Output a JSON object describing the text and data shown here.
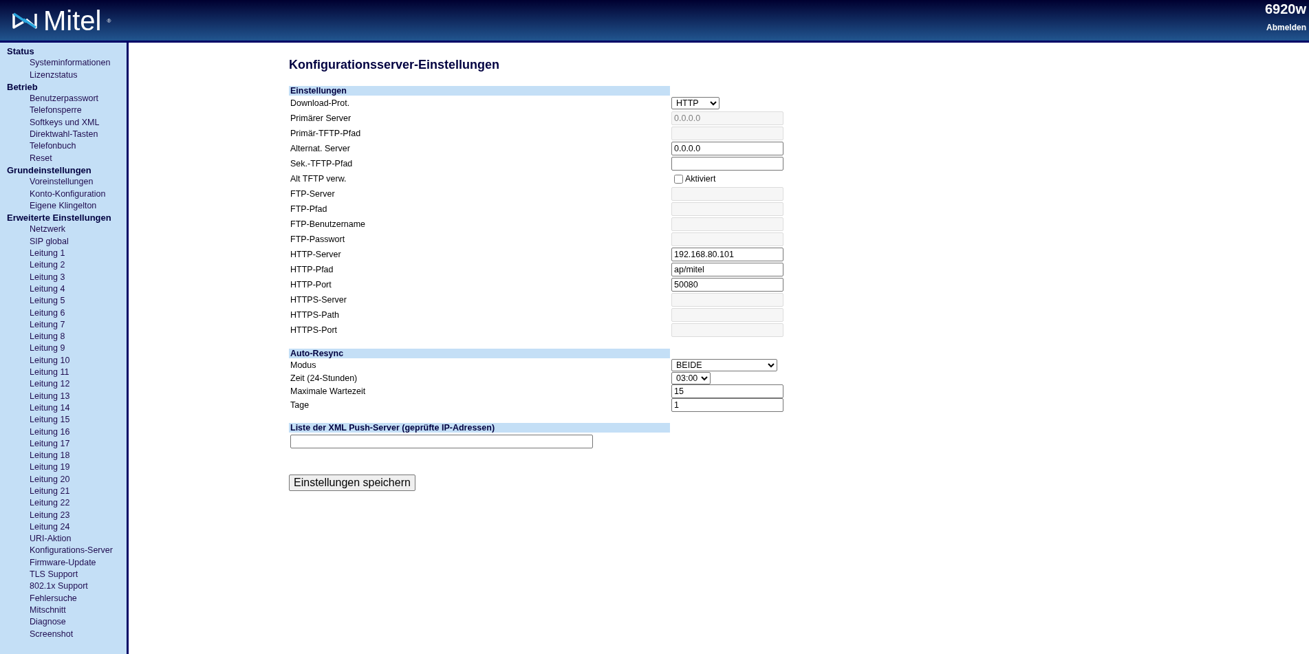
{
  "header": {
    "logo": {
      "text": "Mitel",
      "mark": "®"
    },
    "model": "6920w",
    "logout": "Abmelden"
  },
  "sidebar": {
    "groups": [
      {
        "title": "Status",
        "items": [
          "Systeminformationen",
          "Lizenzstatus"
        ]
      },
      {
        "title": "Betrieb",
        "items": [
          "Benutzerpasswort",
          "Telefonsperre",
          "Softkeys und XML",
          "Direktwahl-Tasten",
          "Telefonbuch",
          "Reset"
        ]
      },
      {
        "title": "Grundeinstellungen",
        "items": [
          "Voreinstellungen",
          "Konto-Konfiguration",
          "Eigene Klingelton"
        ]
      },
      {
        "title": "Erweiterte Einstellungen",
        "items": [
          "Netzwerk",
          "SIP global",
          "Leitung 1",
          "Leitung 2",
          "Leitung 3",
          "Leitung 4",
          "Leitung 5",
          "Leitung 6",
          "Leitung 7",
          "Leitung 8",
          "Leitung 9",
          "Leitung 10",
          "Leitung 11",
          "Leitung 12",
          "Leitung 13",
          "Leitung 14",
          "Leitung 15",
          "Leitung 16",
          "Leitung 17",
          "Leitung 18",
          "Leitung 19",
          "Leitung 20",
          "Leitung 21",
          "Leitung 22",
          "Leitung 23",
          "Leitung 24",
          "URI-Aktion",
          "Konfigurations-Server",
          "Firmware-Update",
          "TLS Support",
          "802.1x Support",
          "Fehlersuche",
          "Mitschnitt",
          "Diagnose",
          "Screenshot"
        ]
      }
    ]
  },
  "page_title": "Konfigurationsserver-Einstellungen",
  "sections": [
    {
      "title": "Einstellungen",
      "rows": [
        {
          "kind": "select",
          "label": "Download-Prot.",
          "value": "HTTP",
          "disabled": false
        },
        {
          "kind": "text",
          "label": "Primärer Server",
          "value": "0.0.0.0",
          "disabled": true
        },
        {
          "kind": "text",
          "label": "Primär-TFTP-Pfad",
          "disabled": true
        },
        {
          "kind": "text",
          "label": "Alternat. Server",
          "value": "0.0.0.0",
          "disabled": false
        },
        {
          "kind": "text",
          "label": "Sek.-TFTP-Pfad",
          "disabled": false
        },
        {
          "kind": "checkbox",
          "label": "Alt TFTP verw.",
          "option": "Aktiviert",
          "checked": false
        },
        {
          "kind": "text",
          "label": "FTP-Server",
          "disabled": true
        },
        {
          "kind": "text",
          "label": "FTP-Pfad",
          "disabled": true
        },
        {
          "kind": "text",
          "label": "FTP-Benutzername",
          "disabled": true
        },
        {
          "kind": "text",
          "label": "FTP-Passwort",
          "disabled": true
        },
        {
          "kind": "text",
          "label": "HTTP-Server",
          "value": "192.168.80.101",
          "disabled": false
        },
        {
          "kind": "text",
          "label": "HTTP-Pfad",
          "value": "ap/mitel",
          "disabled": false
        },
        {
          "kind": "text",
          "label": "HTTP-Port",
          "value": "50080",
          "disabled": false
        },
        {
          "kind": "text",
          "label": "HTTPS-Server",
          "disabled": true
        },
        {
          "kind": "text",
          "label": "HTTPS-Path",
          "disabled": true
        },
        {
          "kind": "text",
          "label": "HTTPS-Port",
          "disabled": true
        }
      ]
    },
    {
      "title": "Auto-Resync",
      "rows": [
        {
          "kind": "select",
          "label": "Modus",
          "value": "BEIDE",
          "disabled": false
        },
        {
          "kind": "select",
          "label": "Zeit (24-Stunden)",
          "value": "03:00",
          "disabled": false
        },
        {
          "kind": "text",
          "label": "Maximale Wartezeit",
          "value": "15",
          "disabled": false
        },
        {
          "kind": "text",
          "label": "Tage",
          "value": "1",
          "disabled": false
        }
      ]
    },
    {
      "title": "Liste der XML Push-Server (geprüfte IP-Adressen)",
      "rows": [
        {
          "kind": "wide",
          "disabled": false
        }
      ]
    }
  ],
  "save_button": "Einstellungen speichern"
}
